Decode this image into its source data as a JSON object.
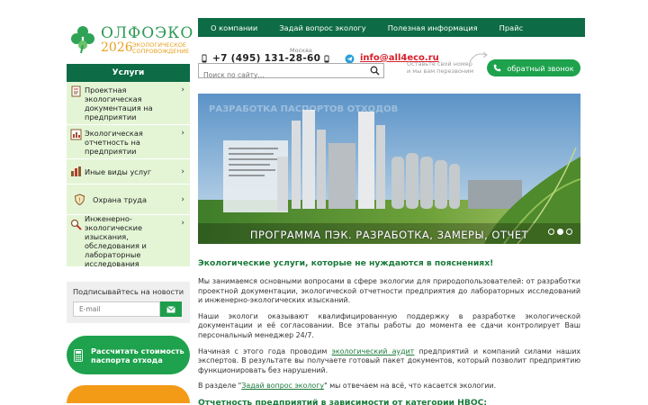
{
  "logo": {
    "name": "ОЛФОЭКО",
    "year": "2026",
    "tagline": "экологическое сопровождение",
    "icon": "clover-icon"
  },
  "nav": {
    "items": [
      "О компании",
      "Задай вопрос экологу",
      "Полезная информация",
      "Прайс"
    ]
  },
  "contacts": {
    "city": "Москва",
    "phone": "+7 (495) 131-28-60",
    "email": "info@all4eco.ru",
    "hint": [
      "Оставьте свой номер",
      "и мы вам перезвоним"
    ],
    "callback_label": "обратный звонок"
  },
  "search": {
    "placeholder": "Поиск по сайту..."
  },
  "sidebar": {
    "services_title": "Услуги",
    "items": [
      {
        "label": "Проектная экологическая документация на предприятии",
        "icon": "document-icon"
      },
      {
        "label": "Экологическая отчетность на предприятии",
        "icon": "report-icon"
      },
      {
        "label": "Иные виды услуг",
        "icon": "services-icon"
      },
      {
        "label": "Охрана труда",
        "icon": "shield-icon"
      },
      {
        "label": "Инженерно-экологические изыскания, обследования и лабораторные исследования",
        "icon": "magnifier-icon"
      }
    ],
    "subscribe_title": "Подписывайтесь на новости",
    "email_placeholder": "E-mail",
    "calc_label": "Рассчитать стоимость паспорта отхода"
  },
  "banner": {
    "caption": "ПРОГРАММА ПЭК. РАЗРАБОТКА, ЗАМЕРЫ, ОТЧЕТ",
    "faded_title": "Разработка паспортов отходов",
    "slides": 3,
    "active_slide": 2
  },
  "content": {
    "heading": "Экологические услуги, которые не нуждаются в пояснениях!",
    "p1": "Мы занимаемся основными вопросами в сфере экологии для природопользователей: от разработки проектной документации, экологической отчетности предприятия до лабораторных исследований и инженерно-экологических изысканий.",
    "p2": "Наши экологи оказывают квалифицированную поддержку в разработке экологической документации и её согласовании. Все этапы работы до момента ее сдачи контролирует Ваш персональный менеджер 24/7.",
    "p3_before": "Начиная с этого года проводим ",
    "p3_link": "экологический аудит",
    "p3_after": " предприятий и компаний силами наших экспертов. В результате вы получаете готовый пакет документов, который позволит предприятию функционировать без нарушений.",
    "p4_before": "В разделе \"",
    "p4_link": "Задай вопрос экологу",
    "p4_after": "\" мы отвечаем на всё, что касается экологии.",
    "subheading": "Отчетность предприятий в зависимости от категории НВОС:"
  },
  "colors": {
    "brand_green": "#0d6b45",
    "accent_green": "#1ea24d",
    "email_red": "#d81f2a",
    "orange": "#f39a17",
    "light_green": "#e4f5d6"
  }
}
